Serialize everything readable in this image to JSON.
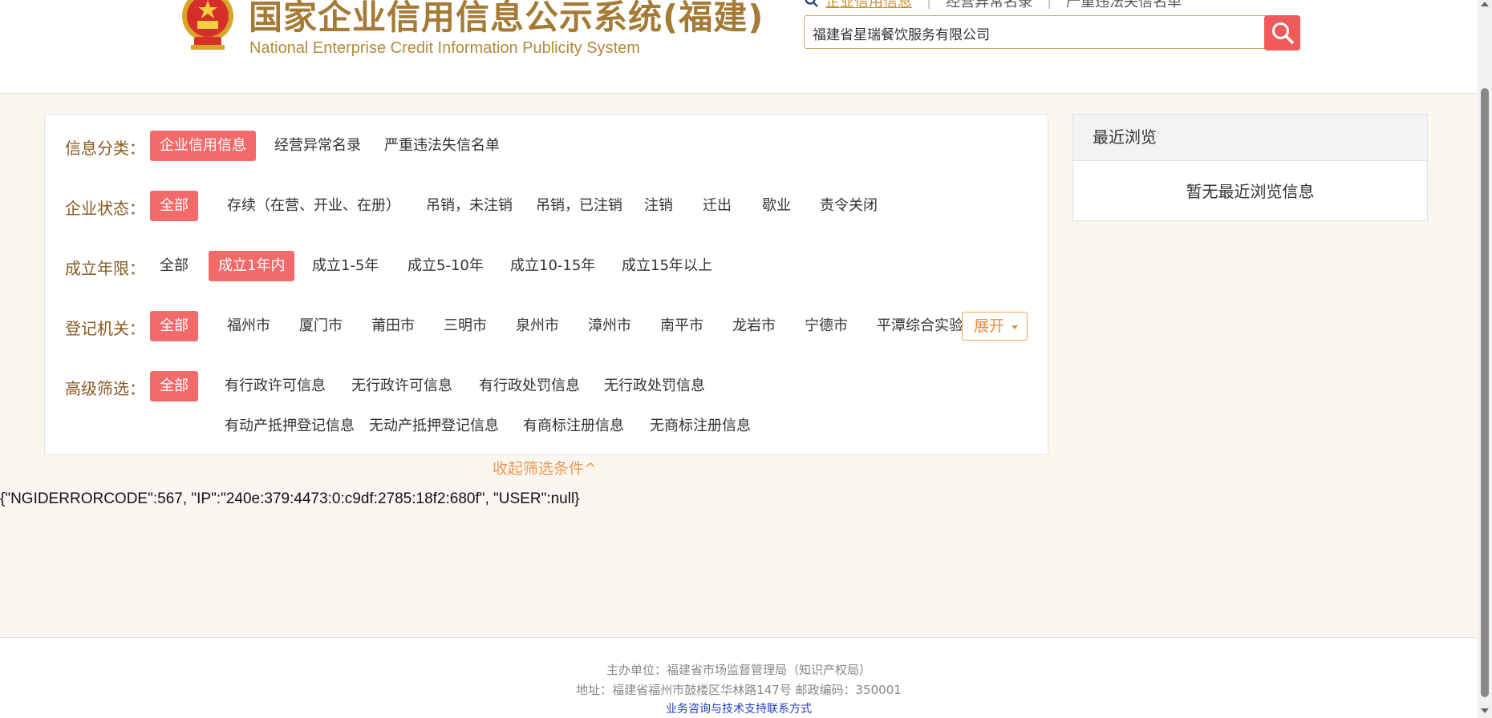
{
  "header": {
    "logo_cn": "国家企业信用信息公示系统(福建)",
    "logo_en": "National Enterprise Credit Information Publicity System",
    "emblem_icon": "national-emblem-icon",
    "nav": [
      {
        "label": "企业信用信息",
        "active": true
      },
      {
        "label": "经营异常名录",
        "active": false
      },
      {
        "label": "严重违法失信名单",
        "active": false
      }
    ],
    "search": {
      "value": "福建省星瑞餐饮服务有限公司",
      "button_icon": "search-icon"
    }
  },
  "filters": {
    "category": {
      "label": "信息分类：",
      "options": [
        "企业信用信息",
        "经营异常名录",
        "严重违法失信名单"
      ],
      "selected": "企业信用信息"
    },
    "status": {
      "label": "企业状态：",
      "options": [
        "全部",
        "存续（在营、开业、在册）",
        "吊销，未注销",
        "吊销，已注销",
        "注销",
        "迁出",
        "歇业",
        "责令关闭"
      ],
      "selected": "全部"
    },
    "age": {
      "label": "成立年限：",
      "options": [
        "全部",
        "成立1年内",
        "成立1-5年",
        "成立5-10年",
        "成立10-15年",
        "成立15年以上"
      ],
      "selected": "成立1年内"
    },
    "authority": {
      "label": "登记机关：",
      "options": [
        "全部",
        "福州市",
        "厦门市",
        "莆田市",
        "三明市",
        "泉州市",
        "漳州市",
        "南平市",
        "龙岩市",
        "宁德市",
        "平潭综合实验区"
      ],
      "selected": "全部",
      "expand_label": "展开"
    },
    "advanced": {
      "label": "高级筛选：",
      "options": [
        "全部",
        "有行政许可信息",
        "无行政许可信息",
        "有行政处罚信息",
        "无行政处罚信息",
        "有动产抵押登记信息",
        "无动产抵押登记信息",
        "有商标注册信息",
        "无商标注册信息"
      ],
      "selected": "全部"
    },
    "collapse_label": "收起筛选条件^"
  },
  "error_text": "{\"NGIDERRORCODE\":567, \"IP\":\"240e:379:4473:0:c9df:2785:18f2:680f\", \"USER\":null}",
  "recent": {
    "title": "最近浏览",
    "empty": "暂无最近浏览信息"
  },
  "footer": {
    "host": "主办单位：福建省市场监督管理局（知识产权局）",
    "address": "地址：福建省福州市鼓楼区华林路147号  邮政编码：350001",
    "contact_link": "业务咨询与技术支持联系方式"
  },
  "colors": {
    "accent_red": "#f26a6a",
    "label_brown": "#8a5a23",
    "gold": "#a47a35",
    "link_orange": "#ee9a55"
  }
}
